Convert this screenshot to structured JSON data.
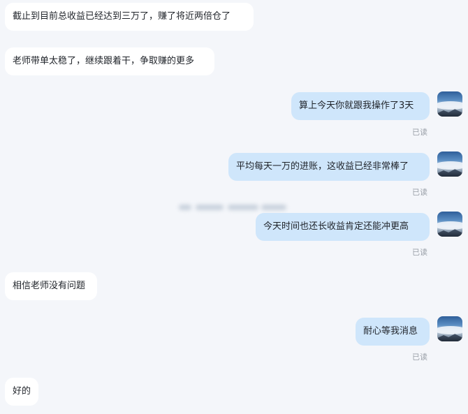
{
  "messages": [
    {
      "side": "left",
      "text": "截止到目前总收益已经达到三万了，赚了将近两倍仓了"
    },
    {
      "side": "left",
      "text": "老师带单太稳了，继续跟着干，争取赚的更多"
    },
    {
      "side": "right",
      "text": "算上今天你就跟我操作了3天",
      "status": "已读"
    },
    {
      "side": "right",
      "text": "平均每天一万的进账，这收益已经非常棒了",
      "status": "已读"
    },
    {
      "side": "right",
      "text": "今天时间也还长收益肯定还能冲更高",
      "status": "已读"
    },
    {
      "side": "left",
      "text": "相信老师没有问题"
    },
    {
      "side": "right",
      "text": "耐心等我消息",
      "status": "已读"
    },
    {
      "side": "left",
      "text": "好的"
    }
  ],
  "colors": {
    "background": "#f4f6fa",
    "left_bubble": "#ffffff",
    "right_bubble": "#cfe6fb",
    "read_status": "#9aa0a8"
  },
  "icons": {
    "avatar": "mountain-clouds-avatar-icon",
    "redacted": "blurred-redacted-text"
  }
}
